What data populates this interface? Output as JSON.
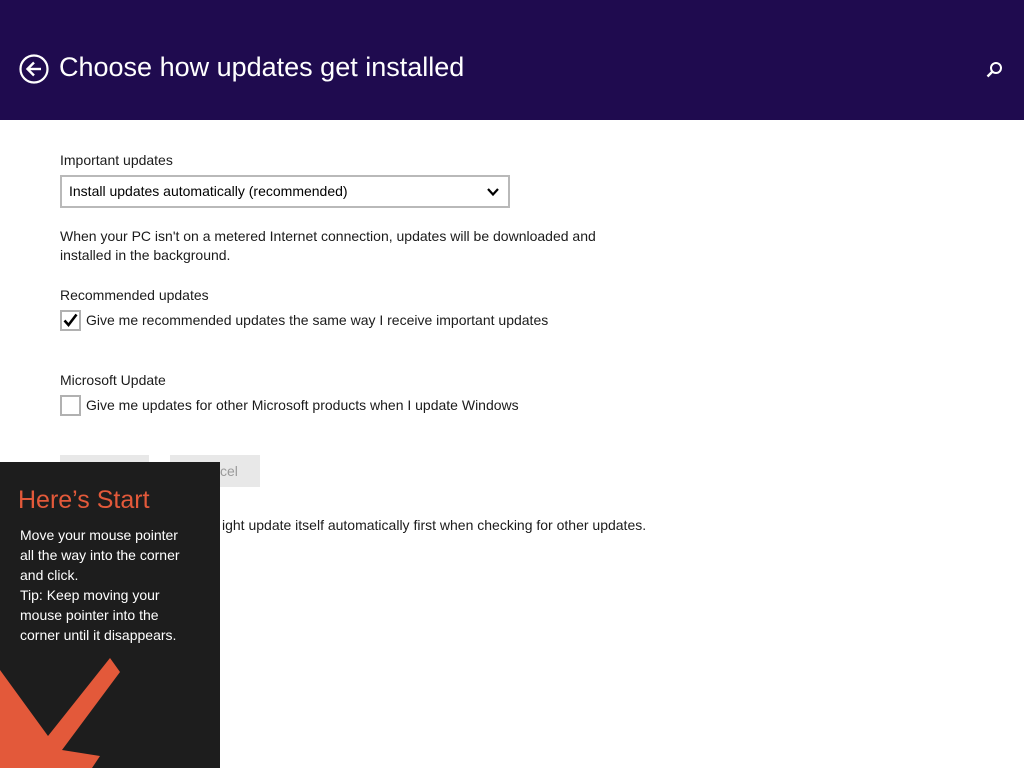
{
  "header": {
    "title": "Choose how updates get installed",
    "back_icon": "back-arrow-circle-icon",
    "search_icon": "search-icon",
    "background_color": "#1f0b4f"
  },
  "important_updates": {
    "label": "Important updates",
    "selected_option": "Install updates automatically (recommended)",
    "description_line1": "When your PC isn't on a metered Internet connection, updates will be downloaded and",
    "description_line2": "installed in the background."
  },
  "recommended_updates": {
    "label": "Recommended updates",
    "checkbox_label": "Give me recommended updates the same way I receive important updates",
    "checked": true
  },
  "microsoft_update": {
    "label": "Microsoft Update",
    "checkbox_label": "Give me updates for other Microsoft products when I update Windows",
    "checked": false
  },
  "buttons": {
    "apply_label": "",
    "cancel_label": "cel"
  },
  "footnote": "ight update itself automatically first when checking for other updates.",
  "start_tip": {
    "title": "Here’s Start",
    "lines": [
      "Move your mouse pointer",
      "all the way into the corner",
      "and click.",
      "Tip: Keep moving your",
      "mouse pointer into the",
      "corner until it disappears."
    ],
    "accent_color": "#e3593a",
    "arrow_icon": "arrow-down-left-icon"
  }
}
